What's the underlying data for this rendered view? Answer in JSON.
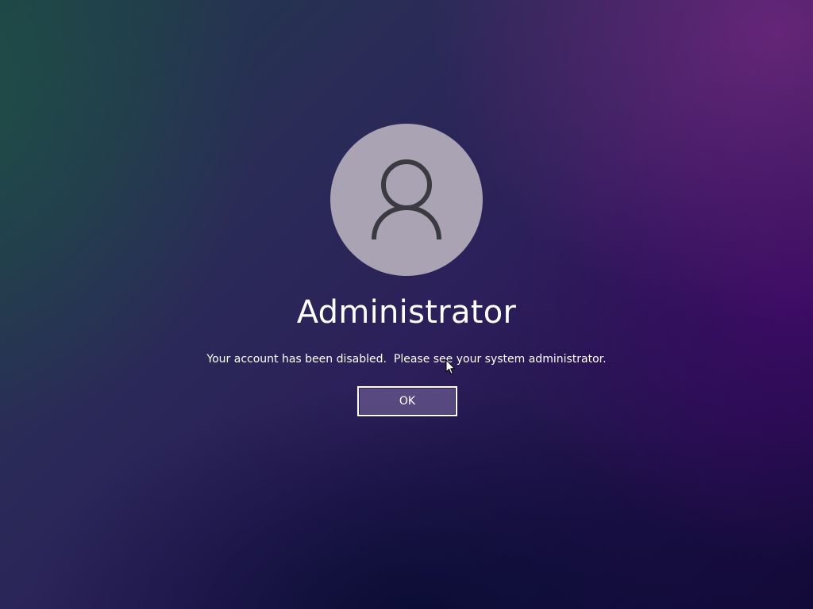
{
  "user": {
    "name": "Administrator",
    "avatar_icon": "user-silhouette-icon"
  },
  "message": {
    "text": "Your account has been disabled.  Please see your system administrator."
  },
  "actions": {
    "ok_label": "OK"
  },
  "colors": {
    "avatar_background": "#a9a3b3",
    "avatar_icon_stroke": "#3b3a40",
    "button_border": "#ffffff",
    "button_fill": "#5f5087",
    "text": "#ffffff"
  }
}
